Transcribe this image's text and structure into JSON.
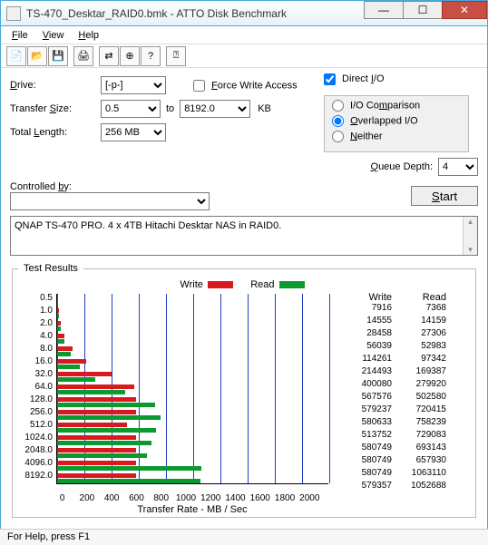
{
  "window": {
    "title": "TS-470_Desktar_RAID0.bmk - ATTO Disk Benchmark"
  },
  "menu": {
    "file": "File",
    "view": "View",
    "help": "Help"
  },
  "toolbar_icons": [
    "new",
    "open",
    "save",
    "print",
    "sep",
    "arrows",
    "target",
    "help",
    "context-help"
  ],
  "form": {
    "drive_label": "Drive:",
    "drive_value": "[-p-]",
    "transfer_label": "Transfer Size:",
    "transfer_from": "0.5",
    "transfer_to_label": "to",
    "transfer_to": "8192.0",
    "kb": "KB",
    "total_length_label": "Total Length:",
    "total_length": "256 MB",
    "force_write": "Force Write Access",
    "direct_io": "Direct I/O",
    "io_comparison": "I/O Comparison",
    "overlapped_io": "Overlapped I/O",
    "neither": "Neither",
    "queue_depth_label": "Queue Depth:",
    "queue_depth": "4",
    "controlled_by": "Controlled by:",
    "controlled_value": "",
    "start": "Start",
    "description": "QNAP TS-470 PRO.  4 x 4TB Hitachi Desktar NAS in RAID0."
  },
  "results": {
    "legend_title": "Test Results",
    "write_label": "Write",
    "read_label": "Read",
    "xlabel": "Transfer Rate - MB / Sec"
  },
  "chart_data": {
    "type": "bar",
    "orientation": "horizontal",
    "categories": [
      "0.5",
      "1.0",
      "2.0",
      "4.0",
      "8.0",
      "16.0",
      "32.0",
      "64.0",
      "128.0",
      "256.0",
      "512.0",
      "1024.0",
      "2048.0",
      "4096.0",
      "8192.0"
    ],
    "series": [
      {
        "name": "Write",
        "color": "#d81920",
        "values": [
          7916,
          14555,
          28458,
          56039,
          114261,
          214493,
          400080,
          567576,
          579237,
          580633,
          513752,
          580749,
          580749,
          580749,
          579357
        ]
      },
      {
        "name": "Read",
        "color": "#0a9a2f",
        "values": [
          7368,
          14159,
          27306,
          52983,
          97342,
          169387,
          279920,
          502580,
          720415,
          758239,
          729083,
          693143,
          657930,
          1063110,
          1052688
        ]
      }
    ],
    "xlabel": "Transfer Rate - MB / Sec",
    "xticks": [
      0,
      200,
      400,
      600,
      800,
      1000,
      1200,
      1400,
      1600,
      1800,
      2000
    ],
    "xlim": [
      0,
      2000
    ],
    "ylabel": ""
  },
  "statusbar": "For Help, press F1"
}
